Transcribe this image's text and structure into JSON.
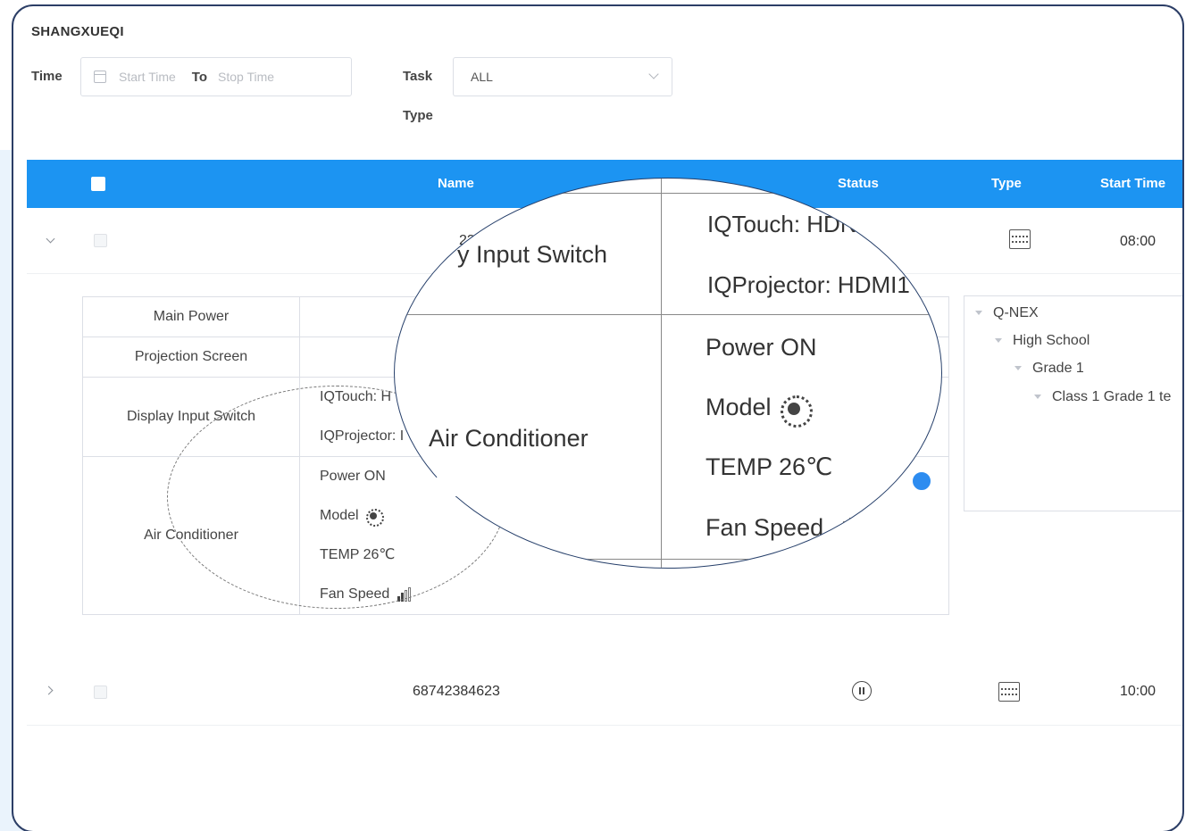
{
  "app": {
    "title": "SHANGXUEQI"
  },
  "filters": {
    "time_label": "Time",
    "start_placeholder": "Start Time",
    "to_label": "To",
    "stop_placeholder": "Stop Time",
    "task_type_label_1": "Task",
    "task_type_label_2": "Type",
    "task_type_value": "ALL"
  },
  "table": {
    "headers": {
      "name": "Name",
      "status": "Status",
      "type": "Type",
      "start_time": "Start Time"
    },
    "rows": [
      {
        "name": "232",
        "start_time": "08:00",
        "status_icon": "pause-icon",
        "type_icon": "device-icon",
        "expanded": true
      },
      {
        "name": "68742384623",
        "start_time": "10:00",
        "status_icon": "pause-icon",
        "type_icon": "device-icon",
        "expanded": false
      }
    ]
  },
  "detail": {
    "main_power": "Main Power",
    "projection_screen": "Projection Screen",
    "display_input_switch": "Display Input Switch",
    "iqtouch": "IQTouch: H",
    "iqprojector": "IQProjector: I",
    "air_conditioner": "Air Conditioner",
    "power": "Power ON",
    "model": "Model",
    "temp": "TEMP 26℃",
    "fan_speed": "Fan Speed"
  },
  "tree": {
    "root": "Q-NEX",
    "level1": "High School",
    "level2": "Grade 1",
    "level3": "Class 1 Grade 1 te"
  },
  "magnifier": {
    "input_switch": "y Input Switch",
    "iqtouch": "IQTouch: HDN",
    "iqprojector": "IQProjector: HDMI1",
    "air_conditioner": "Air Conditioner",
    "power": "Power ON",
    "model": "Model",
    "temp": "TEMP 26℃",
    "fan_speed": "Fan Speed"
  },
  "colors": {
    "header_bg": "#1c94f2",
    "frame_border": "#2c3e66",
    "toggle_accent": "#2d8cf0"
  }
}
